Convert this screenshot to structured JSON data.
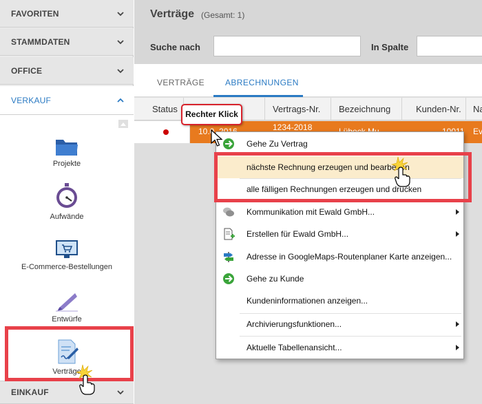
{
  "sidebar": {
    "sections": [
      {
        "label": "FAVORITEN"
      },
      {
        "label": "STAMMDATEN"
      },
      {
        "label": "OFFICE"
      },
      {
        "label": "VERKAUF"
      },
      {
        "label": "EINKAUF"
      }
    ],
    "items": [
      {
        "label": "Projekte",
        "icon": "folder-icon"
      },
      {
        "label": "Aufwände",
        "icon": "stopwatch-icon"
      },
      {
        "label": "E-Commerce-Bestellungen",
        "icon": "shopping-cart-icon"
      },
      {
        "label": "Entwürfe",
        "icon": "quill-icon"
      },
      {
        "label": "Verträge",
        "icon": "contract-icon"
      }
    ]
  },
  "header": {
    "title": "Verträge",
    "count": "(Gesamt: 1)",
    "search_label": "Suche nach",
    "column_label": "In Spalte"
  },
  "tabs": [
    {
      "label": "VERTRÄGE"
    },
    {
      "label": "ABRECHNUNGEN"
    }
  ],
  "table": {
    "columns": [
      "Status",
      "Vertrags-Nr.",
      "Bezeichnung",
      "Kunden-Nr.",
      "Na"
    ],
    "row": {
      "date": "10.0_2016",
      "contract_no": "1234-2018",
      "bezeichnung": "Lübeck Mu",
      "kunden_nr": "10011",
      "name": "Ev"
    }
  },
  "callout": {
    "text": "Rechter Klick"
  },
  "context_menu": [
    {
      "label": "Gehe Zu Vertrag",
      "icon": "green-arrow-icon",
      "submenu": false
    },
    {
      "label": "nächste Rechnung erzeugen und bearbeiten",
      "icon": "",
      "submenu": false,
      "highlighted": true
    },
    {
      "label": "alle fälligen Rechnungen erzeugen und drucken",
      "icon": "",
      "submenu": false
    },
    {
      "label": "Kommunikation mit Ewald GmbH...",
      "icon": "speech-bubbles-icon",
      "submenu": true
    },
    {
      "label": "Erstellen für Ewald GmbH...",
      "icon": "new-document-icon",
      "submenu": true
    },
    {
      "label": "Adresse in GoogleMaps-Routenplaner Karte anzeigen...",
      "icon": "signpost-icon",
      "submenu": false
    },
    {
      "label": "Gehe zu Kunde",
      "icon": "green-arrow-icon",
      "submenu": false
    },
    {
      "label": "Kundeninformationen anzeigen...",
      "icon": "",
      "submenu": false
    },
    {
      "label": "Archivierungsfunktionen...",
      "icon": "",
      "submenu": true
    },
    {
      "label": "Aktuelle Tabellenansicht...",
      "icon": "",
      "submenu": true
    }
  ],
  "colors": {
    "accent": "#2a7ac3",
    "selection": "#e87a1e",
    "highlight_box": "#e8414a",
    "menu_highlight": "#fbeccc"
  }
}
